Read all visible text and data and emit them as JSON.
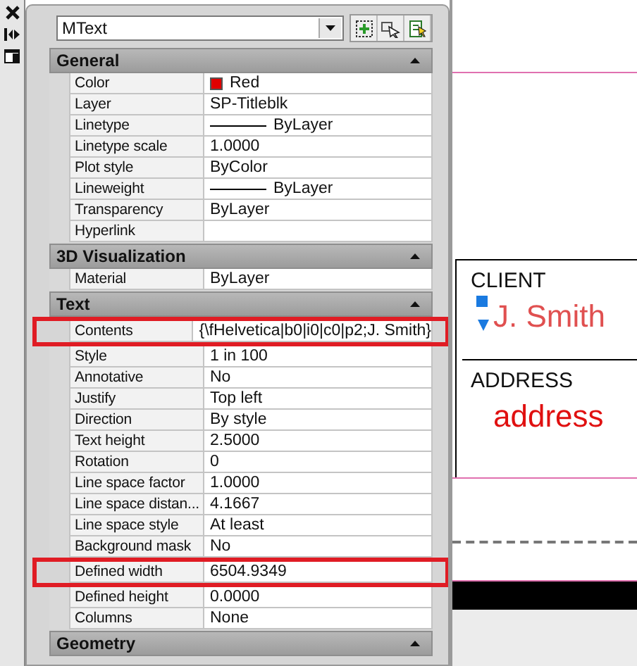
{
  "palette": {
    "object_type": "MText",
    "sections": [
      {
        "title": "General",
        "expanded": true,
        "rows": [
          {
            "label": "Color",
            "value": "Red",
            "kind": "color",
            "color": "#e00000",
            "highlighted": false
          },
          {
            "label": "Layer",
            "value": "SP-Titleblk",
            "kind": "text",
            "highlighted": false
          },
          {
            "label": "Linetype",
            "value": "ByLayer",
            "kind": "line",
            "highlighted": false
          },
          {
            "label": "Linetype scale",
            "value": "1.0000",
            "kind": "text",
            "highlighted": false
          },
          {
            "label": "Plot style",
            "value": "ByColor",
            "kind": "text",
            "highlighted": false
          },
          {
            "label": "Lineweight",
            "value": "ByLayer",
            "kind": "line",
            "highlighted": false
          },
          {
            "label": "Transparency",
            "value": "ByLayer",
            "kind": "text",
            "highlighted": false
          },
          {
            "label": "Hyperlink",
            "kind": "text",
            "highlighted": false
          }
        ]
      },
      {
        "title": "3D Visualization",
        "expanded": true,
        "rows": [
          {
            "label": "Material",
            "value": "ByLayer",
            "kind": "text",
            "highlighted": false
          }
        ]
      },
      {
        "title": "Text",
        "expanded": true,
        "rows": [
          {
            "label": "Contents",
            "value": "{\\fHelvetica|b0|i0|c0|p2;J. Smith}",
            "kind": "text",
            "highlighted": true
          },
          {
            "label": "Style",
            "value": "1 in 100",
            "kind": "text",
            "highlighted": false
          },
          {
            "label": "Annotative",
            "value": "No",
            "kind": "text",
            "highlighted": false
          },
          {
            "label": "Justify",
            "value": "Top left",
            "kind": "text",
            "highlighted": false
          },
          {
            "label": "Direction",
            "value": "By style",
            "kind": "text",
            "highlighted": false
          },
          {
            "label": "Text height",
            "value": "2.5000",
            "kind": "text",
            "highlighted": false
          },
          {
            "label": "Rotation",
            "value": "0",
            "kind": "text",
            "highlighted": false
          },
          {
            "label": "Line space factor",
            "value": "1.0000",
            "kind": "text",
            "highlighted": false
          },
          {
            "label": "Line space distan...",
            "value": "4.1667",
            "kind": "text",
            "highlighted": false
          },
          {
            "label": "Line space style",
            "value": "At least",
            "kind": "text",
            "highlighted": false
          },
          {
            "label": "Background mask",
            "value": "No",
            "kind": "text",
            "highlighted": false
          },
          {
            "label": "Defined width",
            "value": "6504.9349",
            "kind": "text",
            "highlighted": true
          },
          {
            "label": "Defined height",
            "value": "0.0000",
            "kind": "text",
            "highlighted": false
          },
          {
            "label": "Columns",
            "value": "None",
            "kind": "text",
            "highlighted": false
          }
        ]
      },
      {
        "title": "Geometry",
        "expanded": true
      }
    ]
  },
  "drawing": {
    "fields": [
      {
        "label": "CLIENT",
        "value": "J. Smith",
        "selected": true
      },
      {
        "label": "ADDRESS",
        "value": "address",
        "selected": false
      }
    ]
  }
}
